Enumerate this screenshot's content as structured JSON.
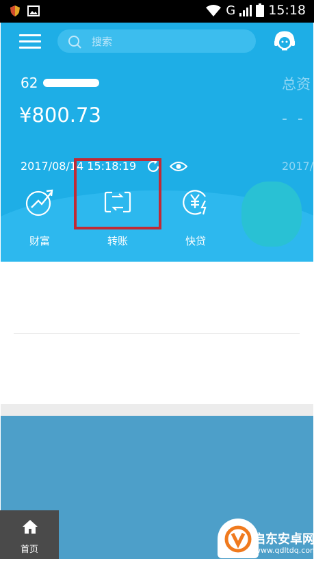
{
  "status_bar": {
    "network": "G",
    "time": "15:18"
  },
  "header": {
    "search_placeholder": "搜索"
  },
  "account": {
    "number_prefix": "62",
    "balance": "¥800.73",
    "timestamp": "2017/08/14 15:18:19",
    "total_assets_label": "总资",
    "total_assets_value": "- - -",
    "second_date": "2017/"
  },
  "actions": [
    {
      "label": "财富",
      "icon": "wealth-growth-icon"
    },
    {
      "label": "转账",
      "icon": "transfer-icon"
    },
    {
      "label": "快贷",
      "icon": "quick-loan-icon"
    }
  ],
  "bottom_nav": {
    "home_label": "首页"
  },
  "watermark": {
    "title": "启东安卓网",
    "url": "www.qdltdq.com"
  },
  "colors": {
    "primary_blue": "#1eaee6",
    "highlight_red": "#c02a35",
    "overlay_blue": "#4d9fc9",
    "watermark_orange": "#f07a1e"
  }
}
